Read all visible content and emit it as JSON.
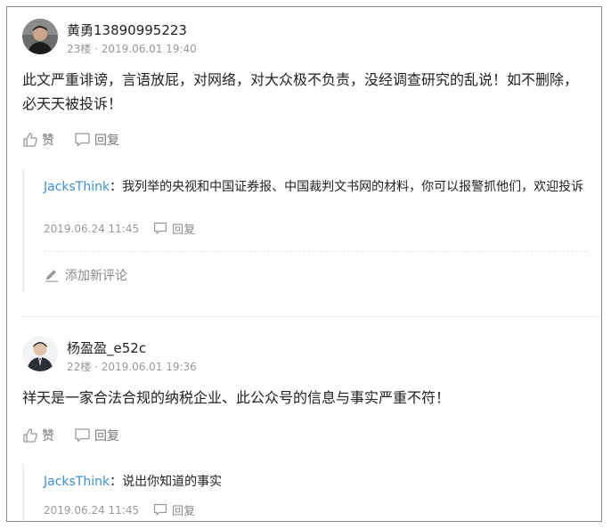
{
  "comments": [
    {
      "author": "黄勇13890995223",
      "meta": "23楼 · 2019.06.01 19:40",
      "text": "此文严重诽谤，言语放屁，对网络，对大众极不负责，没经调查研究的乱说！如不删除，必天天被投诉！",
      "like_label": "赞",
      "reply_label": "回复",
      "replies": [
        {
          "user": "JacksThink",
          "colon": "：",
          "text": "我列举的央视和中国证券报、中国裁判文书网的材料，你可以报警抓他们，欢迎投诉",
          "meta": "2019.06.24 11:45",
          "reply_label": "回复"
        }
      ],
      "add_comment_label": "添加新评论"
    },
    {
      "author": "杨盈盈_e52c",
      "meta": "22楼 · 2019.06.01 19:36",
      "text": "祥天是一家合法合规的纳税企业、此公众号的信息与事实严重不符！",
      "like_label": "赞",
      "reply_label": "回复",
      "replies": [
        {
          "user": "JacksThink",
          "colon": "：",
          "text": "说出你知道的事实",
          "meta": "2019.06.24 11:45",
          "reply_label": "回复"
        }
      ]
    }
  ],
  "colors": {
    "link": "#3d8fd0",
    "meta": "#999999",
    "text": "#222222"
  }
}
